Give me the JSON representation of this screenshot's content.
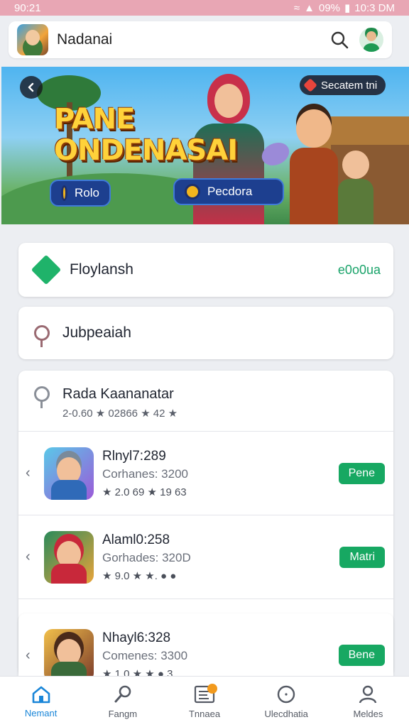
{
  "status": {
    "time": "90:21",
    "battery": "09%",
    "clock": "10:3 DM"
  },
  "app": {
    "title": "Nadanai"
  },
  "banner": {
    "pill_label": "Secatem tni",
    "title_line1": "PANE",
    "title_line2": "ONDENASAI",
    "play_label": "Rolo",
    "reward_label": "Pecdora"
  },
  "cards": [
    {
      "label": "Floylansh",
      "value": "e0o0ua"
    },
    {
      "label": "Jubpeaiah"
    }
  ],
  "list": {
    "title": "Rada Kaananatar",
    "subtitle": "2-0.60 ★ 02866 ★ 42 ★",
    "games": [
      {
        "name": "Rlnyl7:289",
        "genre": "Corhanes: 3200",
        "rating": "★ 2.0 69 ★ 19 63",
        "button": "Pene"
      },
      {
        "name": "Alaml0:258",
        "genre": "Gorhades: 320D",
        "rating": "★ 9.0 ★ ★. ● ●",
        "button": "Matri"
      },
      {
        "name": "Nhayl6:328",
        "genre": "Comenes: 3300",
        "rating": "★ 1.0 ★ ★ ● 3",
        "button": "Bene"
      }
    ]
  },
  "nav": [
    {
      "label": "Nemant",
      "icon": "home-icon"
    },
    {
      "label": "Fangm",
      "icon": "search-icon"
    },
    {
      "label": "Tnnaea",
      "icon": "list-icon"
    },
    {
      "label": "Ulecdhatia",
      "icon": "clock-icon"
    },
    {
      "label": "Meldes",
      "icon": "profile-icon"
    }
  ],
  "colors": {
    "accent": "#17a862",
    "nav_active": "#1a86d8",
    "status_bar": "#e8a6b4"
  }
}
